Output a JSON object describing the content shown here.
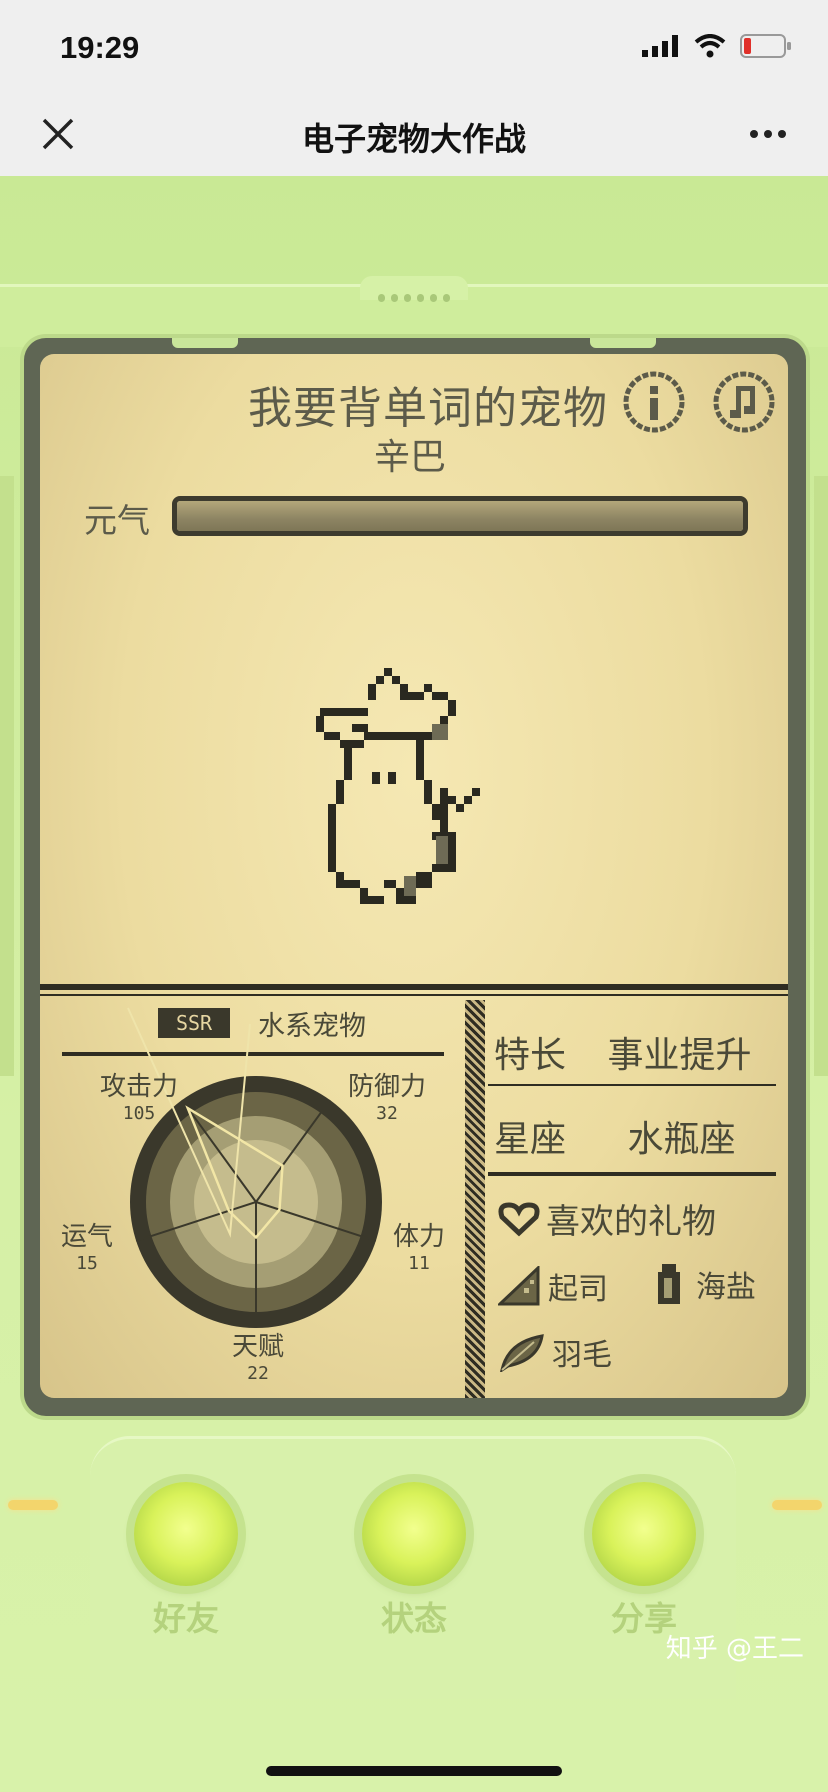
{
  "status_bar": {
    "time": "19:29"
  },
  "nav": {
    "title": "电子宠物大作战"
  },
  "pet": {
    "title": "我要背单词的宠物",
    "name": "辛巴",
    "energy_label": "元气",
    "energy_level": 1.0
  },
  "stats": {
    "rarity": "SSR",
    "type": "水系宠物",
    "attack": {
      "label": "攻击力",
      "value": "105"
    },
    "defense": {
      "label": "防御力",
      "value": "32"
    },
    "luck": {
      "label": "运气",
      "value": "15"
    },
    "stamina": {
      "label": "体力",
      "value": "11"
    },
    "talent": {
      "label": "天赋",
      "value": "22"
    }
  },
  "profile": {
    "specialty_label": "特长",
    "specialty_value": "事业提升",
    "zodiac_label": "星座",
    "zodiac_value": "水瓶座",
    "gifts_title": "喜欢的礼物",
    "gifts": [
      "起司",
      "海盐",
      "羽毛"
    ]
  },
  "buttons": {
    "friends": "好友",
    "status": "状态",
    "share": "分享"
  },
  "watermark": "知乎 @王二",
  "colors": {
    "screen": "#ecdca0",
    "ink": "#3a3a2c",
    "device": "#d4ee9e",
    "button": "#d9f25a"
  }
}
